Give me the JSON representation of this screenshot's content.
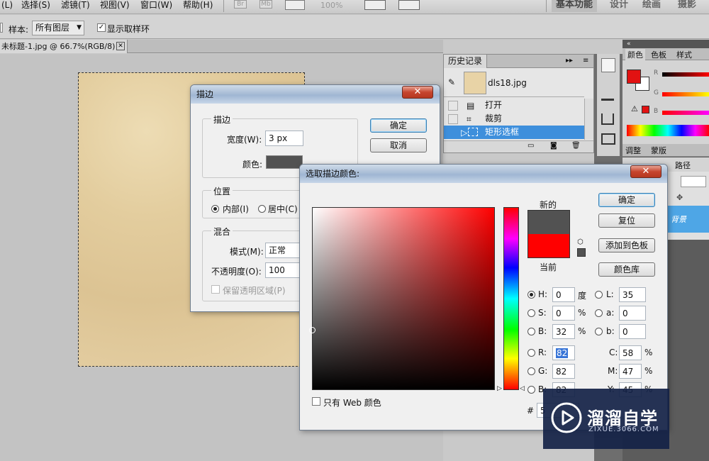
{
  "menubar": {
    "items": [
      "(L)",
      "选择(S)",
      "滤镜(T)",
      "视图(V)",
      "窗口(W)",
      "帮助(H)"
    ],
    "badges": [
      "Br",
      "Mb"
    ],
    "zoom": "100%",
    "workspaces": [
      "基本功能",
      "设计",
      "绘画",
      "摄影"
    ]
  },
  "options": {
    "sample_label": "样本:",
    "sample_value": "所有图层",
    "show_ring_label": "显示取样环"
  },
  "document": {
    "tab_title": "未标题-1.jpg @ 66.7%(RGB/8)",
    "close": "✕"
  },
  "history": {
    "tab": "历史记录",
    "snapshot_name": "dls18.jpg",
    "rows": [
      "打开",
      "裁剪",
      "矩形选框"
    ]
  },
  "right_panels": {
    "color_tabs": [
      "颜色",
      "色板",
      "样式"
    ],
    "channel_letters": [
      "R",
      "G",
      "B"
    ],
    "adjust_tabs": [
      "调整",
      "蒙版"
    ],
    "path_tab": "路径",
    "layer_name": "背景"
  },
  "stroke_dialog": {
    "title": "描边",
    "close": "✕",
    "group_stroke": "描边",
    "width_label": "宽度(W):",
    "width_value": "3 px",
    "color_label": "颜色:",
    "color_swatch": "#525252",
    "group_position": "位置",
    "pos_inside": "内部(I)",
    "pos_center": "居中(C)",
    "group_blend": "混合",
    "mode_label": "模式(M):",
    "mode_value": "正常",
    "opacity_label": "不透明度(O):",
    "opacity_value": "100",
    "preserve_label": "保留透明区域(P)",
    "ok": "确定",
    "cancel": "取消"
  },
  "picker_dialog": {
    "title": "选取描边颜色:",
    "close": "✕",
    "new_label": "新的",
    "current_label": "当前",
    "new_color": "#525252",
    "current_color": "#ff0000",
    "ok": "确定",
    "reset": "复位",
    "add_swatch": "添加到色板",
    "color_library": "颜色库",
    "web_only": "只有 Web 颜色",
    "fields": {
      "H": {
        "label": "H:",
        "value": "0",
        "unit": "度"
      },
      "S": {
        "label": "S:",
        "value": "0",
        "unit": "%"
      },
      "Bv": {
        "label": "B:",
        "value": "32",
        "unit": "%"
      },
      "R": {
        "label": "R:",
        "value": "82"
      },
      "G": {
        "label": "G:",
        "value": "82"
      },
      "B2": {
        "label": "B:",
        "value": "82"
      },
      "L": {
        "label": "L:",
        "value": "35"
      },
      "a": {
        "label": "a:",
        "value": "0"
      },
      "b": {
        "label": "b:",
        "value": "0"
      },
      "C": {
        "label": "C:",
        "value": "58",
        "unit": "%"
      },
      "M": {
        "label": "M:",
        "value": "47",
        "unit": "%"
      },
      "Y": {
        "label": "Y:",
        "value": "45",
        "unit": "%"
      }
    },
    "hex_label": "#",
    "hex_value": "5"
  },
  "watermark": {
    "brand": "溜溜自学",
    "url": "ZIXUE.3066.COM"
  }
}
